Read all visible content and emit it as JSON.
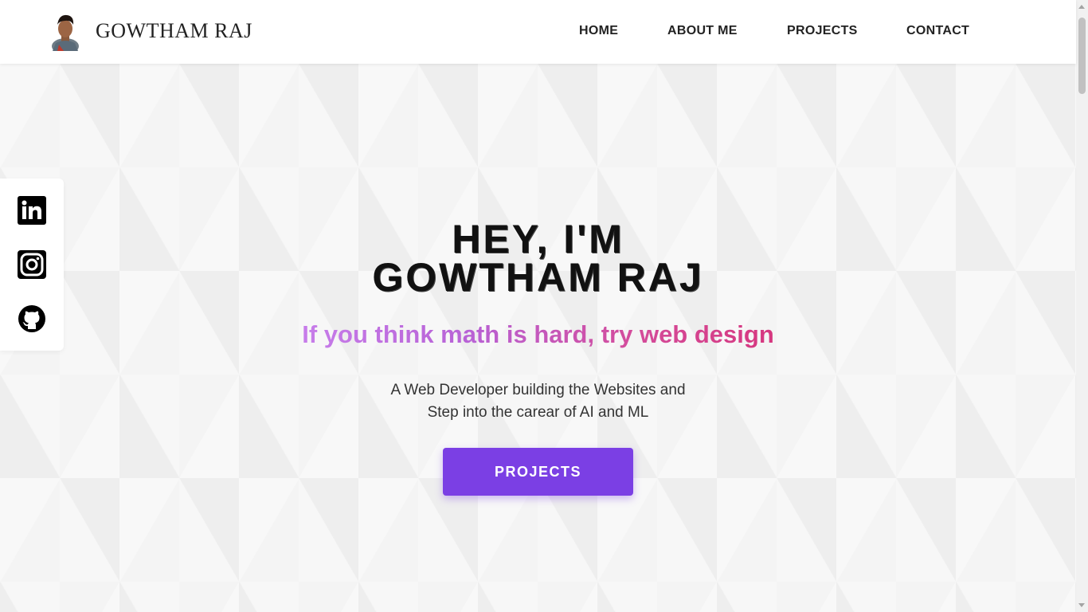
{
  "header": {
    "brand": "GOWTHAM RAJ",
    "avatar_icon": "profile-photo",
    "nav": [
      {
        "label": "HOME"
      },
      {
        "label": "ABOUT ME"
      },
      {
        "label": "PROJECTS"
      },
      {
        "label": "CONTACT"
      }
    ]
  },
  "social": [
    {
      "icon": "linkedin-icon"
    },
    {
      "icon": "instagram-icon"
    },
    {
      "icon": "github-icon"
    }
  ],
  "hero": {
    "title_line1": "HEY, I'M",
    "title_line2": "GOWTHAM RAJ",
    "tagline": "If you think math is hard, try web design",
    "desc_line1": "A Web Developer building the Websites and",
    "desc_line2": "Step into the carear of AI and ML",
    "cta_label": "PROJECTS"
  },
  "colors": {
    "accent": "#7b3fe4",
    "tagline_start": "#c77dea",
    "tagline_end": "#d6377f"
  }
}
